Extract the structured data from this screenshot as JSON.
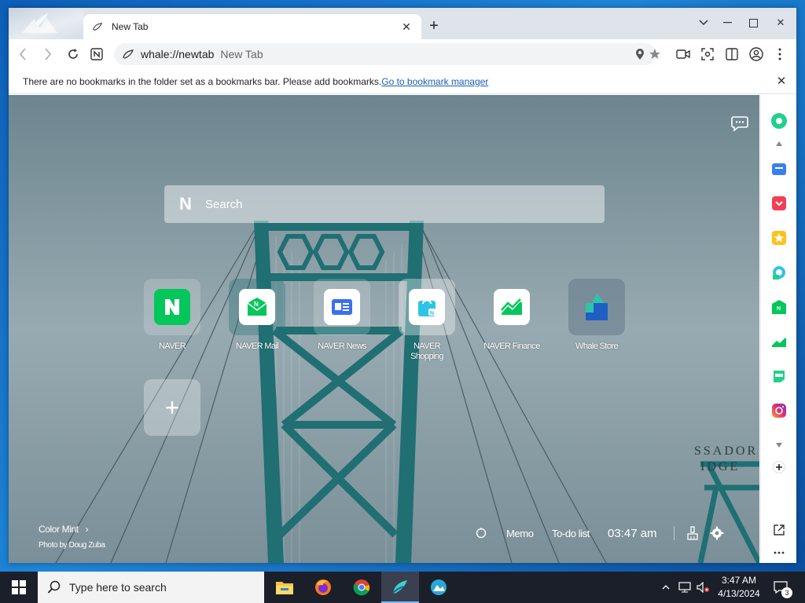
{
  "browser": {
    "tab_title": "New Tab",
    "url": "whale://newtab",
    "url_title": "New Tab",
    "bookmark_message": "There are no bookmarks in the folder set as a bookmarks bar. Please add bookmarks.",
    "bookmark_link": "Go to bookmark manager"
  },
  "newtab": {
    "search_placeholder": "Search",
    "shortcuts": [
      {
        "label": "NAVER"
      },
      {
        "label": "NAVER Mail"
      },
      {
        "label": "NAVER News"
      },
      {
        "label": "NAVER Shopping"
      },
      {
        "label": "NAVER Finance"
      },
      {
        "label": "Whale Store"
      }
    ],
    "theme_label": "Color Mint",
    "photo_credit": "Photo by Doug Zuba",
    "memo_label": "Memo",
    "todo_label": "To-do list",
    "clock": "03:47 am",
    "sign_text_1": "SSADOR",
    "sign_text_2": "IDGE"
  },
  "taskbar": {
    "search_placeholder": "Type here to search",
    "time": "3:47 AM",
    "date": "4/13/2024",
    "notification_count": "3"
  },
  "colors": {
    "naver_green": "#03c75a",
    "whale_blue": "#1a5fb4",
    "taskbar_bg": "#1b1f2a"
  }
}
